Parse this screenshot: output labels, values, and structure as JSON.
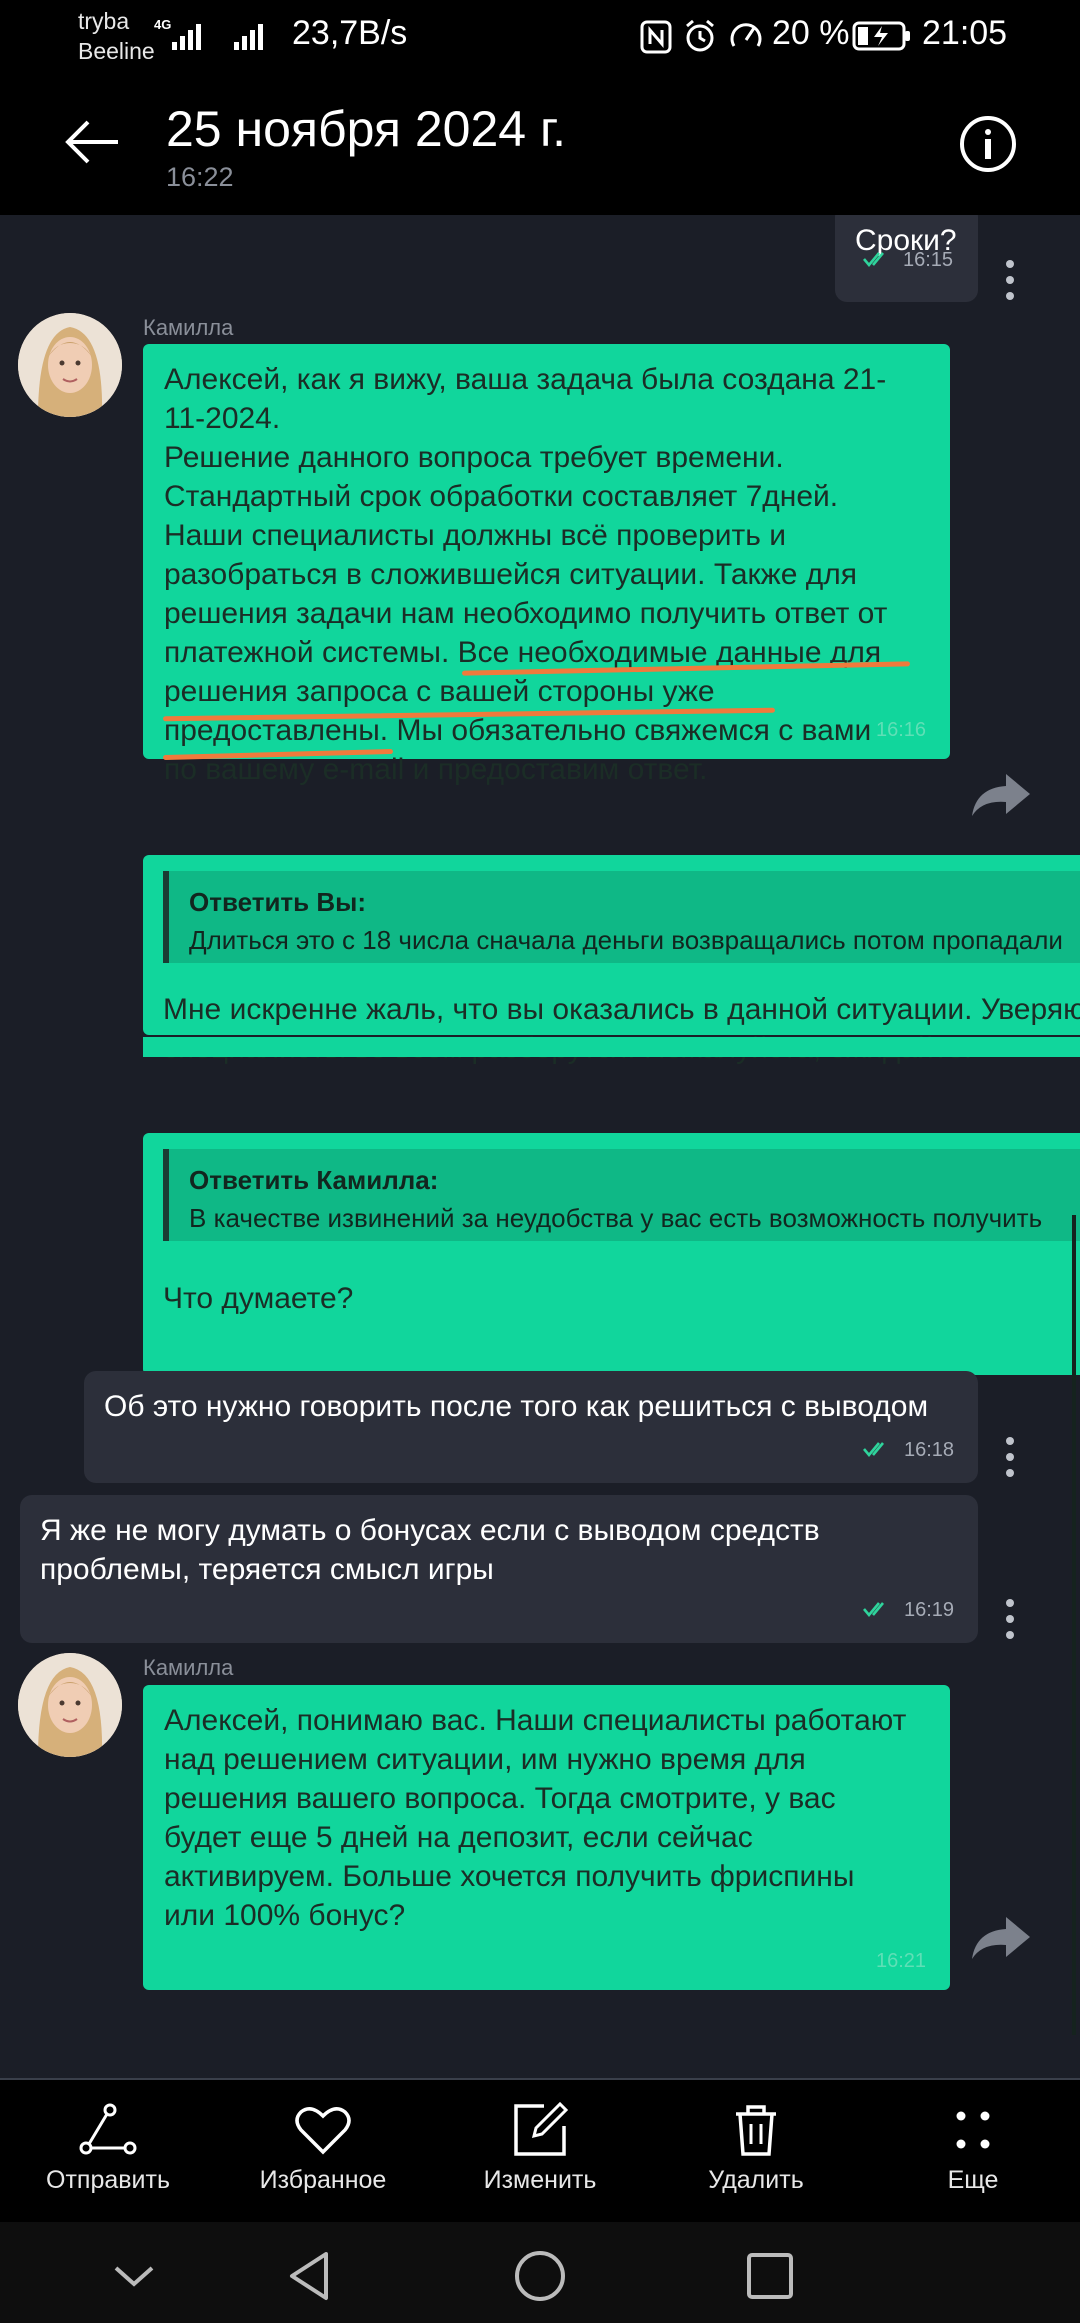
{
  "status_bar": {
    "carrier_1": "tryba",
    "carrier_2": "Beeline",
    "network": "4G",
    "speed": "23,7B/s",
    "battery": "20 %",
    "time": "21:05"
  },
  "header": {
    "title": "25 ноября 2024 г.",
    "subtitle": "16:22"
  },
  "messages": [
    {
      "text": "Сроки?",
      "time": "16:15"
    },
    {
      "sender": "Камилла",
      "text": "Алексей, как я вижу, ваша задача была создана 21-\n11-2024.\nРешение данного вопроса требует времени.\nСтандартный срок обработки составляет 7дней.\nНаши специалисты должны всё проверить и\nразобраться в сложившейся ситуации. Также для\nрешения задачи нам необходимо получить ответ от\nплатежной системы. Все необходимые данные для\nрешения запроса с вашей стороны уже\nпредоставлены. Мы обязательно свяжемся с вами\nпо вашему e-mail и предоставим ответ.",
      "time": "16:16"
    },
    {
      "quote_title": "Ответить Вы:",
      "quote_text": "Длиться это с 18 числа сначала деньги возвращались потом пропадали",
      "text": "Мне искренне жаль, что вы оказались в данной ситуации. Уверяю,\nспециалисты во всем разберутся. Пожалуйста, ожидайте."
    },
    {
      "quote_title": "Ответить Камилла:",
      "quote_text": "В качестве извинений за неудобства у вас есть возможность получить",
      "text": "Что думаете?"
    },
    {
      "text": "Об это нужно говорить после того как решиться с выводом",
      "time": "16:18"
    },
    {
      "text": "Я же не могу думать о бонусах если с выводом средств\nпроблемы, теряется смысл игры",
      "time": "16:19"
    },
    {
      "sender": "Камилла",
      "text": "Алексей, понимаю вас. Наши специалисты работают\nнад решением ситуации, им нужно время для\nрешения вашего вопроса. Тогда смотрите, у вас\nбудет еще 5 дней на депозит, если сейчас\nактивируем. Больше хочется получить фриспины\nили 100% бонус?",
      "time": "16:21"
    }
  ],
  "actions": [
    {
      "label": "Отправить",
      "icon": "share-icon"
    },
    {
      "label": "Избранное",
      "icon": "heart-icon"
    },
    {
      "label": "Изменить",
      "icon": "edit-icon"
    },
    {
      "label": "Удалить",
      "icon": "trash-icon"
    },
    {
      "label": "Еще",
      "icon": "more-icon"
    }
  ],
  "colors": {
    "incoming_bubble": "#11d69c",
    "outgoing_bubble": "#2c2f3a",
    "chat_background": "#1b1e27",
    "underline_mark": "#f07a3c"
  }
}
